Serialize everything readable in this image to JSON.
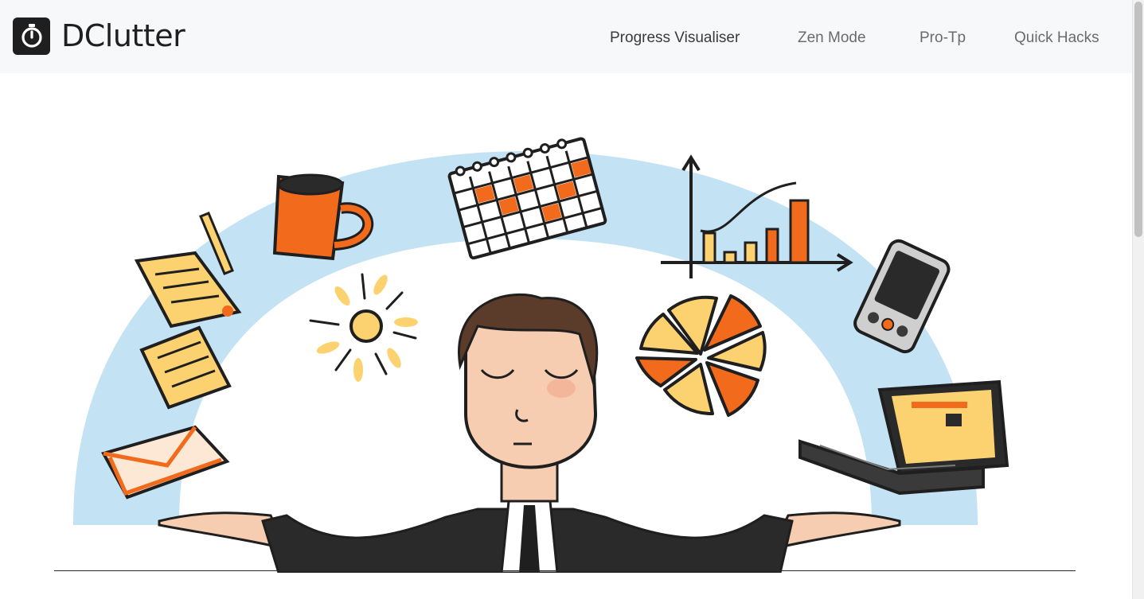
{
  "brand": {
    "name": "DClutter",
    "icon": "stopwatch-icon"
  },
  "nav": {
    "items": [
      {
        "label": "Progress Visualiser",
        "active": true
      },
      {
        "label": "Zen Mode",
        "active": false
      },
      {
        "label": "Pro-Tp",
        "active": false
      },
      {
        "label": "Quick Hacks",
        "active": false
      }
    ]
  },
  "colors": {
    "navbar_bg": "#f7f8fa",
    "accent_orange": "#f26a1b",
    "accent_yellow": "#fcd270",
    "arc_blue": "#c3e2f4",
    "ink": "#1f1f1f"
  }
}
